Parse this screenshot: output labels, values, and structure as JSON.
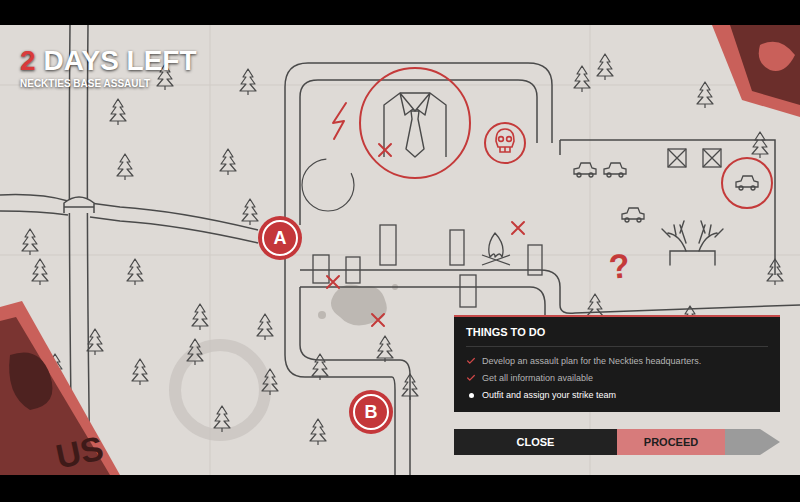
{
  "header": {
    "days": "2",
    "days_label": "DAYS LEFT",
    "mission": "NECKTIES BASE ASSAULT"
  },
  "map": {
    "markers": [
      {
        "label": "A"
      },
      {
        "label": "B"
      }
    ],
    "note": "?",
    "poster_text": "US"
  },
  "panel": {
    "title": "THINGS TO DO",
    "tasks": [
      {
        "label": "Develop an assault plan for the Neckties headquarters.",
        "checked": true
      },
      {
        "label": "Get all information available",
        "checked": true
      },
      {
        "label": "Outfit and assign your strike team",
        "checked": false
      }
    ]
  },
  "buttons": [
    {
      "label": "CLOSE",
      "kind": "secondary"
    },
    {
      "label": "PROCEED",
      "kind": "primary"
    }
  ]
}
